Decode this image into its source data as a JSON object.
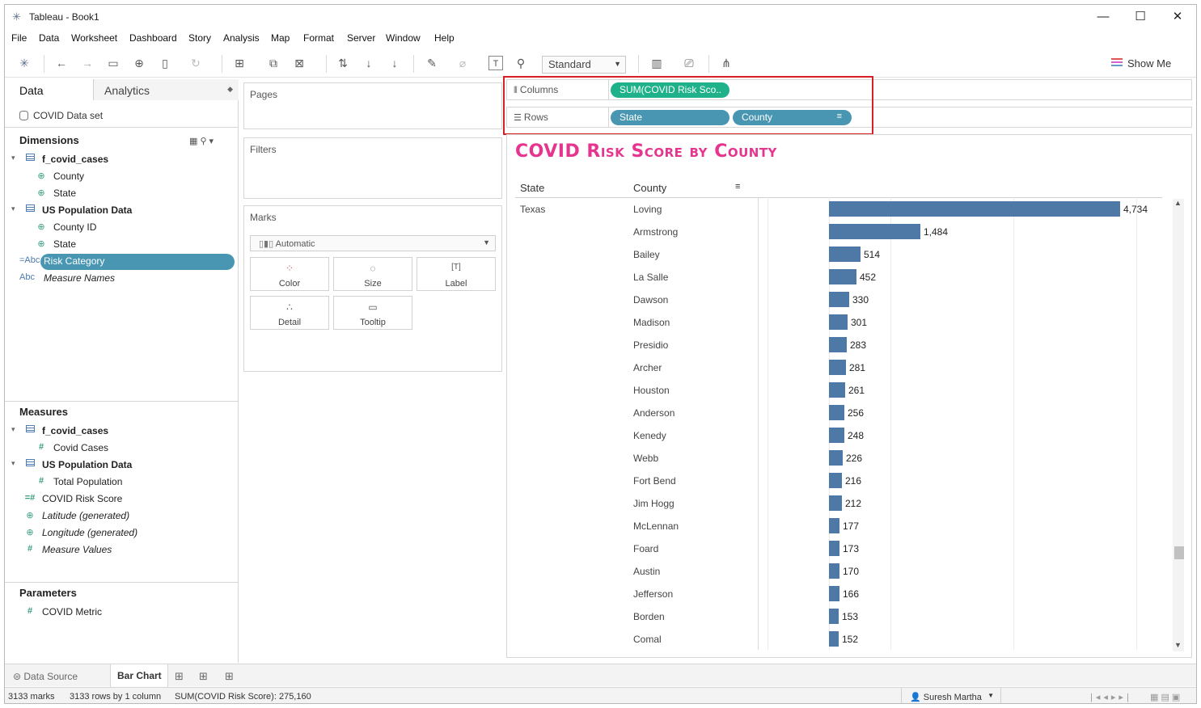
{
  "window": {
    "title": "Tableau - Book1",
    "minimize": "—",
    "maximize": "☐",
    "close": "✕"
  },
  "menu": [
    "File",
    "Data",
    "Worksheet",
    "Dashboard",
    "Story",
    "Analysis",
    "Map",
    "Format",
    "Server",
    "Window",
    "Help"
  ],
  "toolbar": {
    "fit_dropdown": "Standard",
    "show_me": "Show Me"
  },
  "data_pane": {
    "tab_data": "Data",
    "tab_analytics": "Analytics",
    "datasource": "COVID Data set",
    "dimensions_title": "Dimensions",
    "dimensions": [
      {
        "group": "f_covid_cases",
        "fields": [
          "County",
          "State"
        ]
      },
      {
        "group": "US Population Data",
        "fields": [
          "County ID",
          "State"
        ]
      }
    ],
    "risk_category": "Risk Category",
    "measure_names": "Measure Names",
    "measures_title": "Measures",
    "measures": [
      {
        "group": "f_covid_cases",
        "fields": [
          "Covid Cases"
        ]
      },
      {
        "group": "US Population Data",
        "fields": [
          "Total Population"
        ]
      }
    ],
    "covid_risk_score": "COVID Risk Score",
    "latitude": "Latitude (generated)",
    "longitude": "Longitude (generated)",
    "measure_values": "Measure Values",
    "parameters_title": "Parameters",
    "covid_metric": "COVID Metric"
  },
  "cards": {
    "pages": "Pages",
    "filters": "Filters",
    "marks": "Marks",
    "mark_type": "Automatic",
    "color": "Color",
    "size": "Size",
    "label": "Label",
    "detail": "Detail",
    "tooltip": "Tooltip"
  },
  "shelves": {
    "columns_label": "Columns",
    "rows_label": "Rows",
    "columns_pill": "SUM(COVID Risk Sco..",
    "rows_pill_1": "State",
    "rows_pill_2": "County"
  },
  "viz": {
    "title": "COVID Risk Score by County",
    "header_state": "State",
    "header_county": "County",
    "state_value": "Texas"
  },
  "chart_data": {
    "type": "bar",
    "title": "COVID Risk Score by County",
    "xlabel": "",
    "ylabel": "",
    "categories": [
      "Loving",
      "Armstrong",
      "Bailey",
      "La Salle",
      "Dawson",
      "Madison",
      "Presidio",
      "Archer",
      "Houston",
      "Anderson",
      "Kenedy",
      "Webb",
      "Fort Bend",
      "Jim Hogg",
      "McLennan",
      "Foard",
      "Austin",
      "Jefferson",
      "Borden",
      "Comal"
    ],
    "values": [
      4734,
      1484,
      514,
      452,
      330,
      301,
      283,
      281,
      261,
      256,
      248,
      226,
      216,
      212,
      177,
      173,
      170,
      166,
      153,
      152
    ],
    "value_labels": [
      "4,734",
      "1,484",
      "514",
      "452",
      "330",
      "301",
      "283",
      "281",
      "261",
      "256",
      "248",
      "226",
      "216",
      "212",
      "177",
      "173",
      "170",
      "166",
      "153",
      "152"
    ],
    "bar_color": "#4e79a7"
  },
  "sheet_tabs": {
    "data_source": "Data Source",
    "active_sheet": "Bar Chart"
  },
  "status": {
    "marks": "3133 marks",
    "rows_cols": "3133 rows by 1 column",
    "sum": "SUM(COVID Risk Score): 275,160",
    "user": "Suresh Martha"
  }
}
